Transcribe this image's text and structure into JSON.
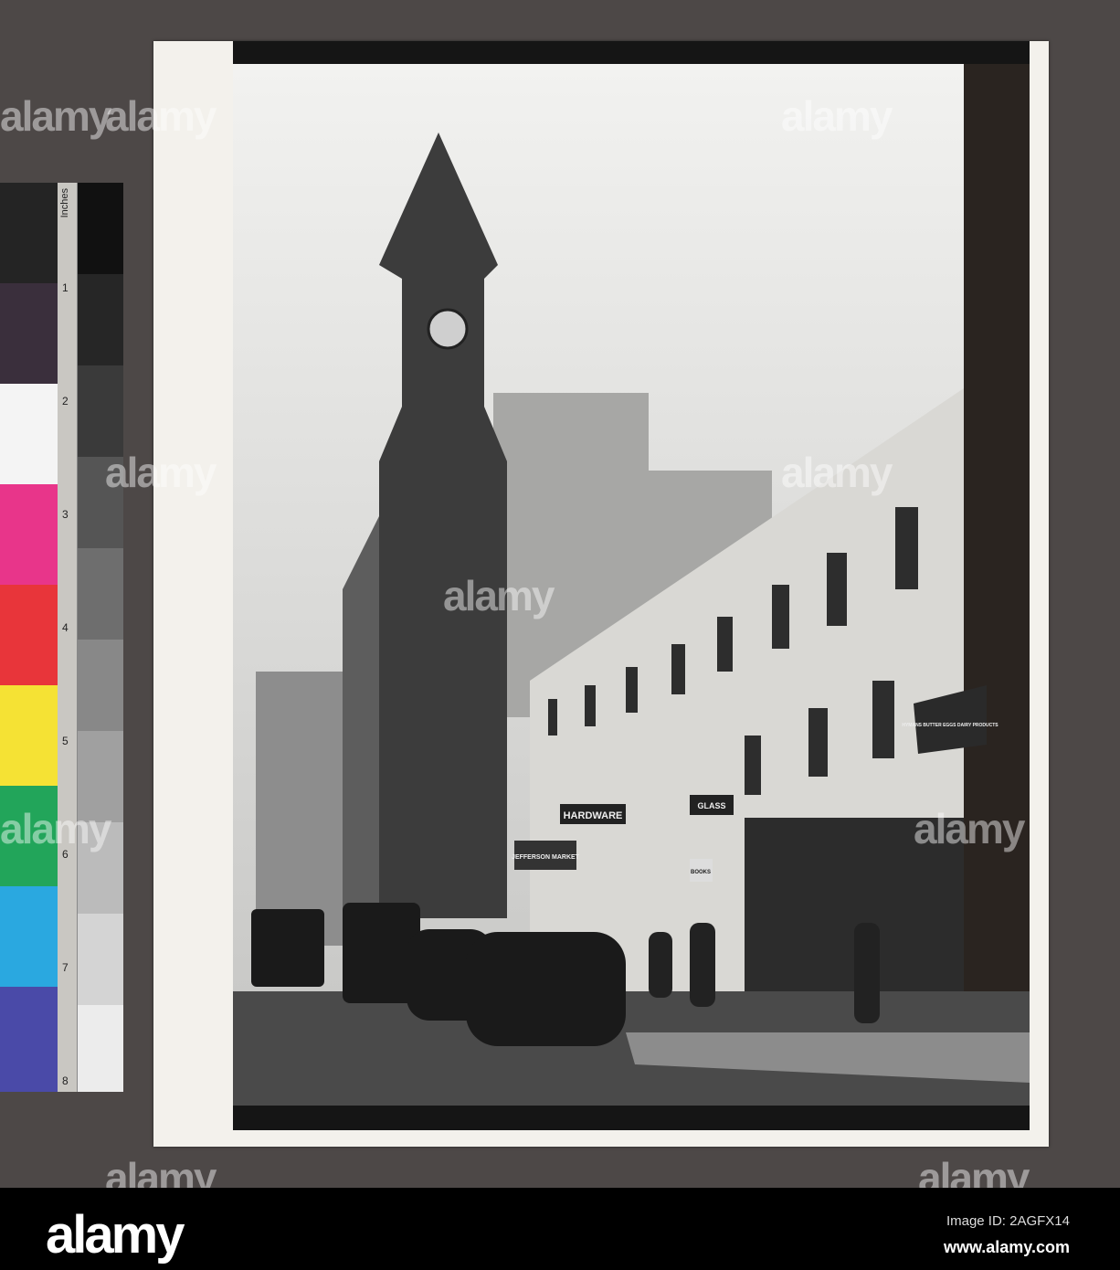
{
  "watermark": "alamy",
  "ruler": {
    "label": "Inches",
    "ticks": [
      "1",
      "2",
      "3",
      "4",
      "5",
      "6",
      "7",
      "8"
    ]
  },
  "color_patches": [
    "#d8d8d8",
    "#3a2f3c",
    "#f4f4f4",
    "#e8358a",
    "#e8353a",
    "#f5e234",
    "#22a55a",
    "#2aa8e0",
    "#4a4aa8"
  ],
  "signs": {
    "hardware": "HARDWARE",
    "market": "JEFFERSON MARKET",
    "books": "BOOKS",
    "glass": "GLASS",
    "dairy": "HYMANS BUTTER EGGS DAIRY PRODUCTS"
  },
  "footer": {
    "logo": "alamy",
    "image_id": "Image ID: 2AGFX14",
    "site": "www.alamy.com"
  }
}
